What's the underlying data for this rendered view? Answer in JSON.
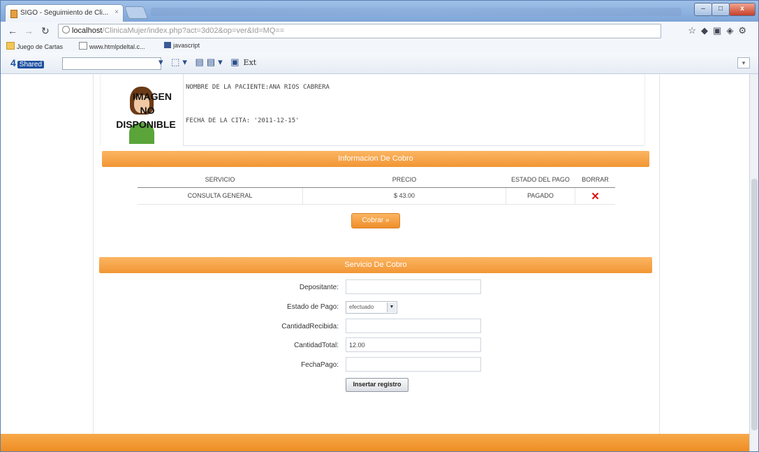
{
  "window": {
    "tab_title": "SIGO - Seguimiento de Cli...",
    "tab_close": "×",
    "minimize": "–",
    "maximize": "□",
    "close": "x"
  },
  "address_bar": {
    "host": "localhost",
    "path": "/ClinicaMujer/index.php?act=3d02&op=ver&Id=MQ=="
  },
  "bookmarks": [
    {
      "label": "Juego de Cartas"
    },
    {
      "label": "www.htmlpdeltal.c..."
    },
    {
      "label": "javascript"
    }
  ],
  "toolbar": {
    "brand": "4",
    "brand_sub": "Shared",
    "glyphs": "▾ ⬚▾ ▤▤▾ ▣",
    "ext_label": "Ext"
  },
  "patient": {
    "photo_text_1": "IMAGEN",
    "photo_text_2": "NO",
    "photo_text_3": "DISPONIBLE",
    "name_line": "NOMBRE DE LA PACIENTE:ANA RIOS CABRERA",
    "date_line": "FECHA DE LA CITA: '2011-12-15'"
  },
  "billing_info": {
    "header": "Informacion De Cobro",
    "columns": [
      "SERVICIO",
      "PRECIO",
      "ESTADO DEL PAGO",
      "BORRAR"
    ],
    "rows": [
      {
        "servicio": "CONSULTA GENERAL",
        "precio": "$ 43.00",
        "estado": "PAGADO",
        "borrar": "✕"
      }
    ],
    "cobrar_label": "Cobrar »"
  },
  "billing_service": {
    "header": "Servicio De Cobro",
    "depositante_label": "Depositante:",
    "depositante_value": "",
    "estado_label": "Estado de Pago:",
    "estado_value": "efectuado",
    "cantidad_recibida_label": "CantidadRecibida:",
    "cantidad_recibida_value": "",
    "cantidad_total_label": "CantidadTotal:",
    "cantidad_total_value": "12.00",
    "fecha_label": "FechaPago:",
    "fecha_value": "",
    "submit_label": "Insertar registro"
  },
  "colors": {
    "accent": "#f29634",
    "delete": "#dd1111"
  }
}
